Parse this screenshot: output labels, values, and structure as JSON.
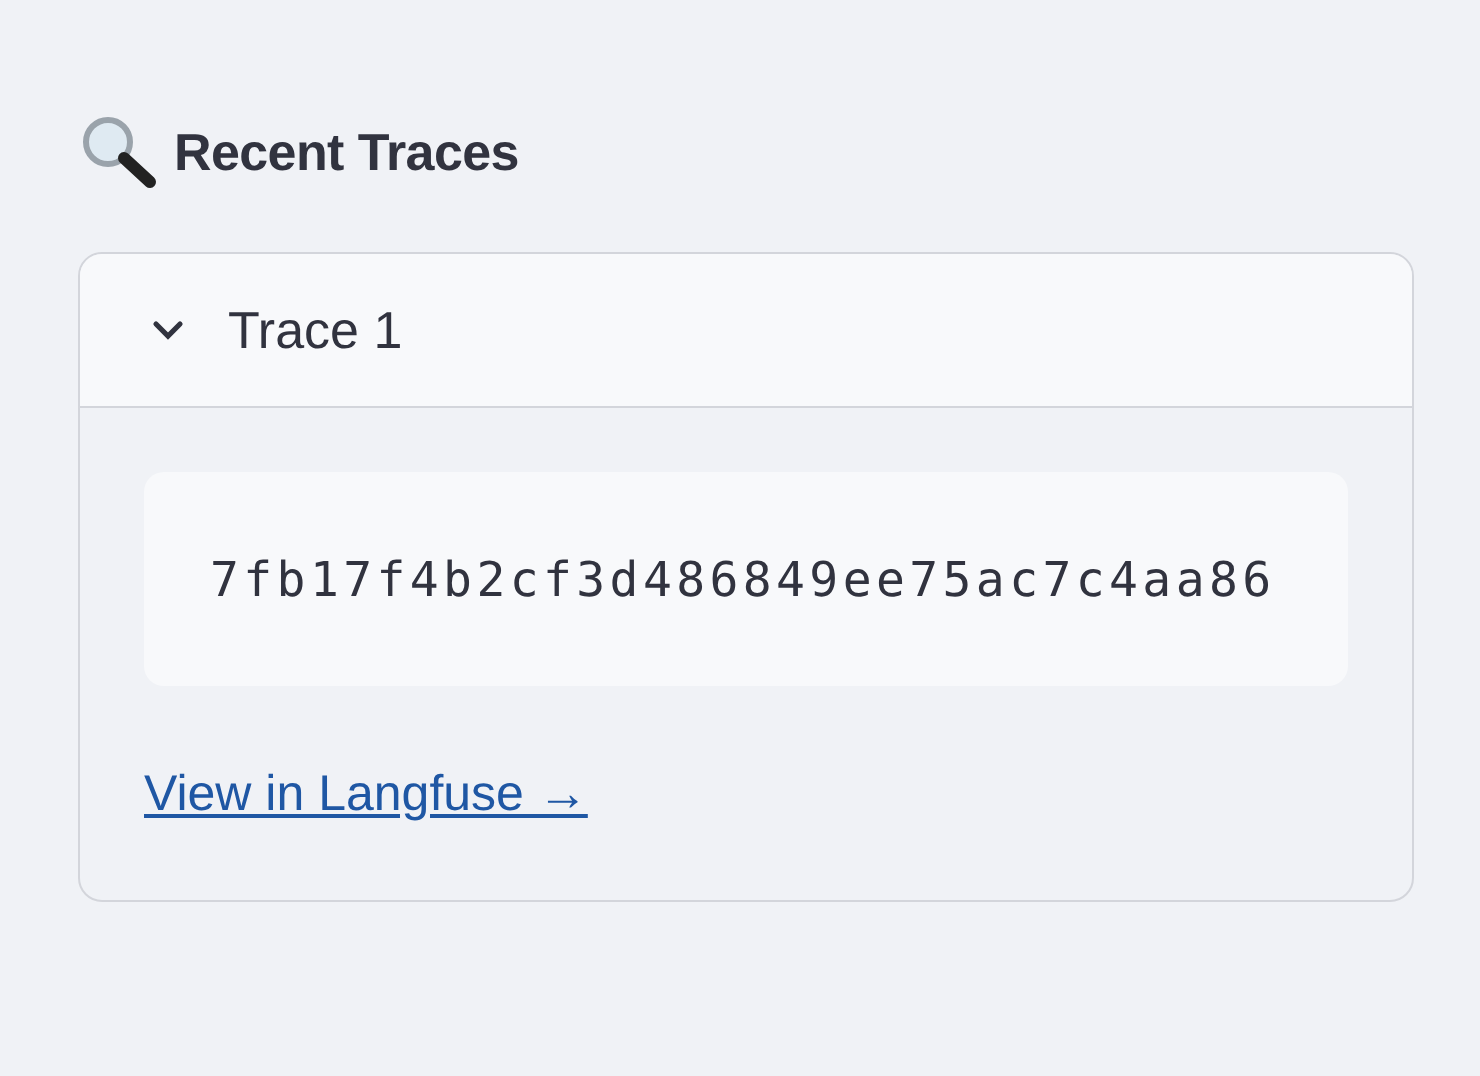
{
  "heading": "Recent Traces",
  "traces": [
    {
      "title": "Trace 1",
      "expanded": true,
      "trace_id": "7fb17f4b2cf3d486849ee75ac7c4aa86",
      "link": "View in Langfuse →"
    }
  ]
}
